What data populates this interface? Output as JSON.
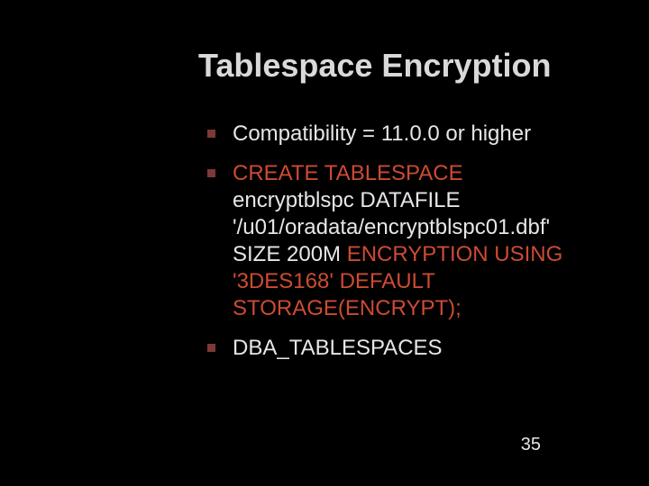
{
  "title": "Tablespace Encryption",
  "bullets": {
    "b1": "Compatibility = 11.0.0 or higher",
    "b2a": "CREATE TABLESPACE",
    "b2b": " encryptblspc DATAFILE '/u01/oradata/encryptblspc01.dbf' SIZE 200M ",
    "b2c": "ENCRYPTION USING '3DES168' DEFAULT STORAGE(ENCRYPT);",
    "b3": "DBA_TABLESPACES"
  },
  "page_number": "35"
}
